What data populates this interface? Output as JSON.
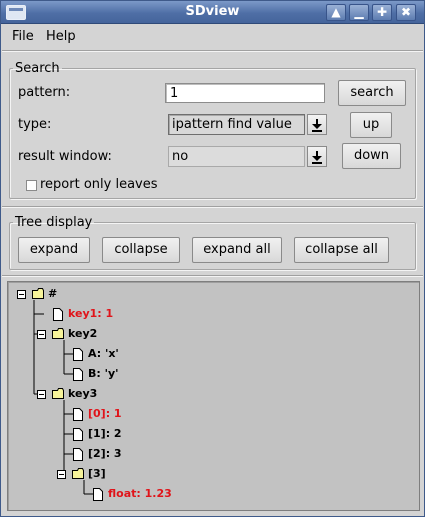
{
  "window": {
    "title": "SDview",
    "controls": [
      {
        "name": "shade-icon",
        "glyph": "▲"
      },
      {
        "name": "minimize-icon",
        "glyph": "▁"
      },
      {
        "name": "maximize-icon",
        "glyph": "✚"
      },
      {
        "name": "close-icon",
        "glyph": "✖"
      }
    ]
  },
  "menubar": {
    "file": "File",
    "help": "Help"
  },
  "search": {
    "legend": "Search",
    "pattern_label": "pattern:",
    "pattern_value": "1",
    "type_label": "type:",
    "type_value": "ipattern find value",
    "result_window_label": "result window:",
    "result_window_value": "no",
    "report_only_leaves": "report only leaves",
    "report_only_leaves_checked": false,
    "search_button": "search",
    "up_button": "up",
    "down_button": "down"
  },
  "tree_display": {
    "legend": "Tree display",
    "expand": "expand",
    "collapse": "collapse",
    "expand_all": "expand all",
    "collapse_all": "collapse all"
  },
  "tree": {
    "match_color": "#e0141a",
    "nodes": [
      {
        "label": "#",
        "kind": "folder",
        "match": false
      },
      {
        "label": "key1: 1",
        "kind": "file",
        "match": true
      },
      {
        "label": "key2",
        "kind": "folder",
        "match": false
      },
      {
        "label": "A: 'x'",
        "kind": "file",
        "match": false
      },
      {
        "label": "B: 'y'",
        "kind": "file",
        "match": false
      },
      {
        "label": "key3",
        "kind": "folder",
        "match": false
      },
      {
        "label": "[0]: 1",
        "kind": "file",
        "match": true
      },
      {
        "label": "[1]: 2",
        "kind": "file",
        "match": false
      },
      {
        "label": "[2]: 3",
        "kind": "file",
        "match": false
      },
      {
        "label": "[3]",
        "kind": "folder",
        "match": false
      },
      {
        "label": "float: 1.23",
        "kind": "file",
        "match": true
      }
    ]
  }
}
